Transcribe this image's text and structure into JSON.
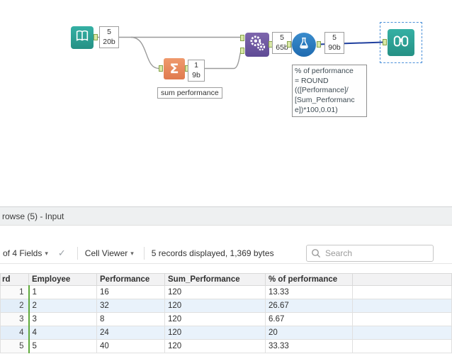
{
  "canvas": {
    "annotations": {
      "input_records": "5",
      "input_size": "20b",
      "summarize_records": "1",
      "summarize_size": "9b",
      "append_records": "5",
      "append_size": "65b",
      "formula_records": "5",
      "formula_size": "90b",
      "summarize_label": "sum performance",
      "formula_comment": "% of performance\n= ROUND\n(([Performance]/\n[Sum_Performanc\ne])*100,0.01)"
    }
  },
  "results_panel": {
    "title": "rowse (5) - Input",
    "toolbar": {
      "fields_dropdown": "of 4 Fields",
      "dropdown_arrow": "▾",
      "check_icon": "✓",
      "cell_viewer": "Cell Viewer",
      "records_info": "5 records displayed, 1,369 bytes",
      "search_placeholder": "Search"
    },
    "table": {
      "columns": [
        "rd",
        "Employee",
        "Performance",
        "Sum_Performance",
        "% of performance"
      ],
      "rows": [
        [
          "1",
          "1",
          "16",
          "120",
          "13.33"
        ],
        [
          "2",
          "2",
          "32",
          "120",
          "26.67"
        ],
        [
          "3",
          "3",
          "8",
          "120",
          "6.67"
        ],
        [
          "4",
          "4",
          "24",
          "120",
          "20"
        ],
        [
          "5",
          "5",
          "40",
          "120",
          "33.33"
        ]
      ]
    }
  },
  "colors": {
    "tool_teal": "#2aa79a",
    "tool_orange": "#e5825e",
    "tool_purple": "#6d5ba6",
    "tool_blue": "#2578bd",
    "anchor_green": "#d9e8a6",
    "wire_gray": "#9b9b9b",
    "wire_selected": "#1f3f9e",
    "row_alt": "#e9f2fb",
    "column_highlight_green": "#5faa3c"
  }
}
